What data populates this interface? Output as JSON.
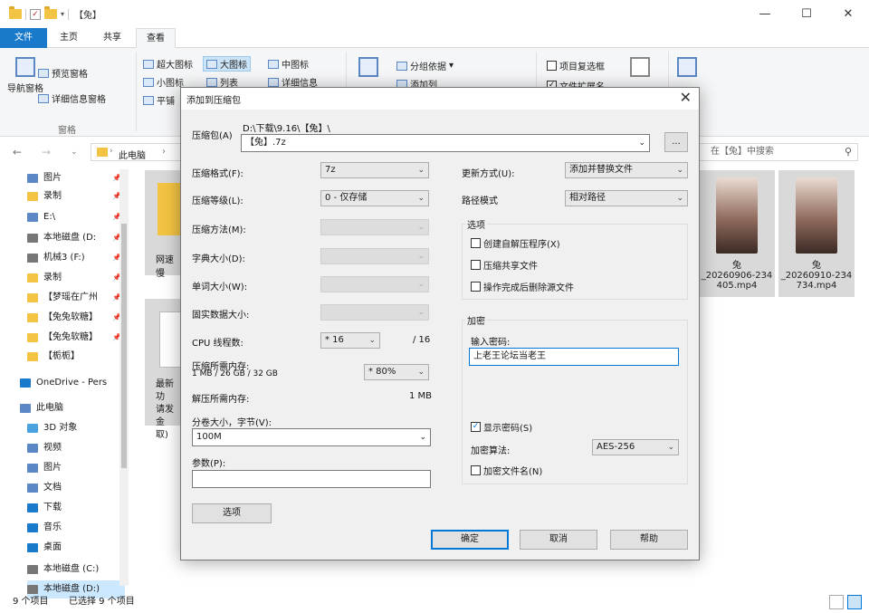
{
  "explorer": {
    "window_title": "【兔】",
    "tabs": [
      "文件",
      "主页",
      "共享",
      "查看"
    ],
    "ribbon": {
      "pane_group": {
        "nav_pane": "导航窗格",
        "preview_pane": "预览窗格",
        "details_pane": "详细信息窗格",
        "label": "窗格"
      },
      "layout": {
        "xlarge": "超大图标",
        "large": "大图标",
        "medium": "中图标",
        "small": "小图标",
        "list": "列表",
        "details": "详细信息",
        "tiles": "平铺"
      },
      "current_view": {
        "group_by": "分组依据",
        "add_column": "添加列"
      },
      "show_hide": {
        "item_checkboxes": "项目复选框",
        "file_extensions": "文件扩展名"
      }
    },
    "address": {
      "crumbs": [
        "此电脑",
        "›"
      ],
      "search_placeholder": "在【兔】中搜索"
    },
    "nav_items": [
      {
        "label": "图片",
        "color": "#5b87c5"
      },
      {
        "label": "录制",
        "color": "#f3c443"
      },
      {
        "label": "E:\\",
        "color": "#5b87c5"
      },
      {
        "label": "本地磁盘 (D:",
        "color": "#777777"
      },
      {
        "label": "机械3 (F:)",
        "color": "#777777"
      },
      {
        "label": "录制",
        "color": "#f3c443"
      },
      {
        "label": "【梦瑶在广州",
        "color": "#f3c443"
      },
      {
        "label": "【兔兔软糖】",
        "color": "#f3c443"
      },
      {
        "label": "【兔兔软糖】",
        "color": "#f3c443"
      },
      {
        "label": "【栀栀】",
        "color": "#f3c443"
      },
      {
        "label": "OneDrive - Pers",
        "color": "#1979ca"
      },
      {
        "label": "此电脑",
        "color": "#5b87c5"
      },
      {
        "label": "3D 对象",
        "color": "#4aa3df"
      },
      {
        "label": "视频",
        "color": "#5b87c5"
      },
      {
        "label": "图片",
        "color": "#5b87c5"
      },
      {
        "label": "文档",
        "color": "#5b87c5"
      },
      {
        "label": "下载",
        "color": "#1979ca"
      },
      {
        "label": "音乐",
        "color": "#1979ca"
      },
      {
        "label": "桌面",
        "color": "#1979ca"
      },
      {
        "label": "本地磁盘 (C:)",
        "color": "#777777"
      },
      {
        "label": "本地磁盘 (D:)",
        "color": "#777777"
      }
    ],
    "tiles_left": {
      "t1": "网速慢",
      "t2a": "最新功",
      "t2b": "请发金",
      "t2c": "取)"
    },
    "files": [
      {
        "name_line1": "兔",
        "name_line2": "_20260906-234",
        "name_line3": "405.mp4"
      },
      {
        "name_line1": "兔",
        "name_line2": "_20260910-234",
        "name_line3": "734.mp4"
      }
    ],
    "status": {
      "count": "9 个项目",
      "selected": "已选择 9 个项目"
    }
  },
  "dialog": {
    "title": "添加到压缩包",
    "archive_label": "压缩包(A)",
    "archive_path": "D:\\下载\\9.16\\【兔】\\",
    "archive_name": "【兔】.7z",
    "browse_label": "...",
    "format_label": "压缩格式(F):",
    "format_value": "7z",
    "level_label": "压缩等级(L):",
    "level_value": "0 - 仅存储",
    "method_label": "压缩方法(M):",
    "dict_label": "字典大小(D):",
    "word_label": "单词大小(W):",
    "solid_label": "固实数据大小:",
    "cpu_label": "CPU 线程数:",
    "cpu_value": "* 16",
    "cpu_max": "/ 16",
    "mem_comp_label": "压缩所需内存:",
    "mem_comp_sub": "1 MB / 26 GB / 32 GB",
    "mem_pct": "* 80%",
    "mem_decomp_label": "解压所需内存:",
    "mem_decomp_value": "1 MB",
    "split_label": "分卷大小，字节(V):",
    "split_value": "100M",
    "params_label": "参数(P):",
    "options_btn": "选项",
    "update_label": "更新方式(U):",
    "update_value": "添加并替换文件",
    "path_label": "路径模式",
    "path_value": "相对路径",
    "options_group": "选项",
    "opt_sfx": "创建自解压程序(X)",
    "opt_shared": "压缩共享文件",
    "opt_delete": "操作完成后删除源文件",
    "encrypt_group": "加密",
    "pwd_label": "输入密码:",
    "pwd_value": "上老王论坛当老王",
    "show_pwd": "显示密码(S)",
    "enc_method_label": "加密算法:",
    "enc_method_value": "AES-256",
    "enc_names": "加密文件名(N)",
    "ok": "确定",
    "cancel": "取消",
    "help": "帮助"
  }
}
